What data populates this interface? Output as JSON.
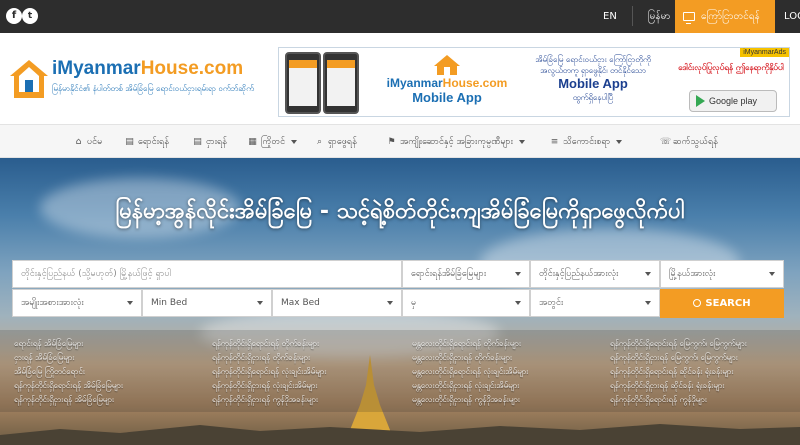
{
  "topbar": {
    "social": [
      {
        "name": "facebook-icon",
        "glyph": "f"
      },
      {
        "name": "twitter-icon",
        "glyph": "t"
      }
    ],
    "lang_en": "EN",
    "lang_mm": "မြန်မာ",
    "sell_label": "ကြော်ငြာတင်ရန်",
    "login_label": "LOG"
  },
  "header": {
    "logo_main": "iMyanmar",
    "logo_accent": "House.com",
    "tagline": "မြန်မာနိုင်ငံ၏ နံပါတ်တစ် အိမ်ခြံမြေ ရောင်းဝယ်ငှားရမ်းရာ ဝက်ဘ်ဆိုက်",
    "banner": {
      "logo_main": "iMyanmar",
      "logo_accent": "House.com",
      "app_label": "Mobile App",
      "mid_line1": "အိမ်ခြံမြေ ရောင်းဝယ်ငှား ကြော်ငြာတိုကို",
      "mid_line2": "အလွယ်တကူ ရှာဖွေနိုင်၊ တင်နိုင်သော",
      "mid_big": "Mobile App",
      "mid_line3": "ထွက်ရှိနေပါပြီ",
      "ad_tag": "iMyanmarAds",
      "red_text": "ဒေါင်းလုပ်ပြုလုပ်ရန် ဤနေရာကိုနှိပ်ပါ",
      "gplay": "Google play"
    }
  },
  "nav": {
    "items": [
      {
        "label": "ပင်မ",
        "icon": "⌂",
        "caret": false
      },
      {
        "label": "ရောင်းရန်",
        "icon": "▤",
        "caret": false
      },
      {
        "label": "ငှားရန်",
        "icon": "▤",
        "caret": false
      },
      {
        "label": "ကြိုတင်",
        "icon": "▦",
        "caret": true
      },
      {
        "label": "ရှာဖွေရန်",
        "icon": "⌕",
        "caret": false
      },
      {
        "label": "အကျိုးဆောင်နှင့် အခြားကုမ္ပဏီများ",
        "icon": "⚑",
        "caret": true
      },
      {
        "label": "သိကောင်းစရာ",
        "icon": "≡",
        "caret": true
      },
      {
        "label": "ဆက်သွယ်ရန်",
        "icon": "☏",
        "caret": false
      }
    ]
  },
  "hero": {
    "title": "မြန်မာ့အွန်လိုင်းအိမ်ခြံမြေ - သင့်ရဲ့စိတ်တိုင်းကျအိမ်ခြံမြေကိုရှာဖွေလိုက်ပါ"
  },
  "search": {
    "keyword_placeholder": "တိုင်းနှင့်ပြည်နယ် (သို့မဟုတ်) မြို့နယ်ဖြင့် ရှာပါ",
    "type": "ရောင်းရန်အိမ်ခြံမြေများ",
    "region": "တိုင်းနှင့်ပြည်နယ်အားလုံး",
    "township": "မြို့နယ်အားလုံး",
    "property_type": "အမျိုးအစားအားလုံး",
    "min_bed": "Min Bed",
    "max_bed": "Max Bed",
    "currency": "မှ",
    "price": "အတွင်း",
    "button": "SEARCH"
  },
  "quick_links": [
    [
      "ရောင်းရန် အိမ်ခြံမြေများ",
      "ရန်ကုန်တိုင်းရှိရောင်းရန် တိုက်ခန်းများ",
      "မန္တလေးတိုင်းရှိရောင်းရန် တိုက်ခန်းများ",
      "ရန်ကုန်တိုင်းရှိရောင်းရန် မြေကွက်၊ မြေကွက်များ"
    ],
    [
      "ငှားရန် အိမ်ခြံမြေများ",
      "ရန်ကုန်တိုင်းရှိငှားရန် တိုက်ခန်းများ",
      "မန္တလေးတိုင်းရှိငှားရန် တိုက်ခန်းများ",
      "ရန်ကုန်တိုင်းရှိငှားရန် မြေကွက်၊ မြေကွက်များ"
    ],
    [
      "အိမ်ခြံမြေ ကြိုတင်ရောင်း",
      "ရန်ကုန်တိုင်းရှိရောင်းရန် လုံးချင်းအိမ်များ",
      "မန္တလေးတိုင်းရှိရောင်းရန် လုံးချင်းအိမ်များ",
      "ရန်ကုန်တိုင်းရှိရောင်းရန် ဆိုင်ခန်း ရုံးခန်းများ"
    ],
    [
      "ရန်ကုန်တိုင်းရှိရောင်းရန် အိမ်ခြံမြေများ",
      "ရန်ကုန်တိုင်းရှိငှားရန် လုံးချင်းအိမ်များ",
      "မန္တလေးတိုင်းရှိငှားရန် လုံးချင်းအိမ်များ",
      "ရန်ကုန်တိုင်းရှိငှားရန် ဆိုင်ခန်း ရုံးခန်းများ"
    ],
    [
      "ရန်ကုန်တိုင်းရှိငှားရန် အိမ်ခြံမြေများ",
      "ရန်ကုန်တိုင်းရှိငှားရန် ကွန်ဒိုအခန်းများ",
      "မန္တလေးတိုင်းရှိငှားရန် ကွန်ဒိုအခန်းများ",
      "ရန်ကုန်တိုင်းရှိရောင်းရန် ကွန်ဒိုများ"
    ]
  ],
  "colors": {
    "accent": "#f39c23",
    "brand_blue": "#1b6fb3",
    "topbar": "#2d2d2d"
  }
}
